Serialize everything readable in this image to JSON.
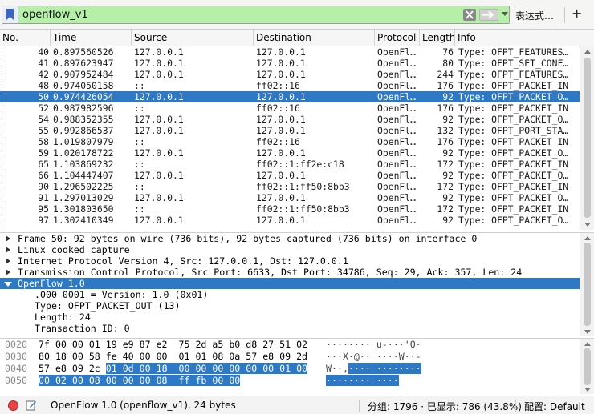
{
  "filter": {
    "value": "openflow_v1",
    "expression_label": "表达式…",
    "add_label": "+"
  },
  "packet_list": {
    "columns": [
      "No.",
      "Time",
      "Source",
      "Destination",
      "Protocol",
      "Length",
      "Info"
    ],
    "selected_no": "50",
    "rows": [
      {
        "no": "40",
        "time": "0.897560526",
        "source": "127.0.0.1",
        "destination": "127.0.0.1",
        "protocol": "OpenFl…",
        "length": "76",
        "info": "Type: OFPT_FEATURES…"
      },
      {
        "no": "41",
        "time": "0.897623947",
        "source": "127.0.0.1",
        "destination": "127.0.0.1",
        "protocol": "OpenFl…",
        "length": "80",
        "info": "Type: OFPT_SET_CONF…"
      },
      {
        "no": "42",
        "time": "0.907952484",
        "source": "127.0.0.1",
        "destination": "127.0.0.1",
        "protocol": "OpenFl…",
        "length": "244",
        "info": "Type: OFPT_FEATURES…"
      },
      {
        "no": "48",
        "time": "0.974050158",
        "source": "::",
        "destination": "ff02::16",
        "protocol": "OpenFl…",
        "length": "176",
        "info": "Type: OFPT_PACKET_IN"
      },
      {
        "no": "50",
        "time": "0.974426054",
        "source": "127.0.0.1",
        "destination": "127.0.0.1",
        "protocol": "OpenFl…",
        "length": "92",
        "info": "Type: OFPT_PACKET_O…"
      },
      {
        "no": "52",
        "time": "0.987982596",
        "source": "::",
        "destination": "ff02::16",
        "protocol": "OpenFl…",
        "length": "176",
        "info": "Type: OFPT_PACKET_IN"
      },
      {
        "no": "54",
        "time": "0.988352355",
        "source": "127.0.0.1",
        "destination": "127.0.0.1",
        "protocol": "OpenFl…",
        "length": "92",
        "info": "Type: OFPT_PACKET_O…"
      },
      {
        "no": "55",
        "time": "0.992866537",
        "source": "127.0.0.1",
        "destination": "127.0.0.1",
        "protocol": "OpenFl…",
        "length": "132",
        "info": "Type: OFPT_PORT_STA…"
      },
      {
        "no": "58",
        "time": "1.019807979",
        "source": "::",
        "destination": "ff02::16",
        "protocol": "OpenFl…",
        "length": "176",
        "info": "Type: OFPT_PACKET_IN"
      },
      {
        "no": "59",
        "time": "1.020178722",
        "source": "127.0.0.1",
        "destination": "127.0.0.1",
        "protocol": "OpenFl…",
        "length": "92",
        "info": "Type: OFPT_PACKET_O…"
      },
      {
        "no": "65",
        "time": "1.103869232",
        "source": "::",
        "destination": "ff02::1:ff2e:c18",
        "protocol": "OpenFl…",
        "length": "172",
        "info": "Type: OFPT_PACKET_IN"
      },
      {
        "no": "66",
        "time": "1.104447407",
        "source": "127.0.0.1",
        "destination": "127.0.0.1",
        "protocol": "OpenFl…",
        "length": "92",
        "info": "Type: OFPT_PACKET_O…"
      },
      {
        "no": "90",
        "time": "1.296502225",
        "source": "::",
        "destination": "ff02::1:ff50:8bb3",
        "protocol": "OpenFl…",
        "length": "172",
        "info": "Type: OFPT_PACKET_IN"
      },
      {
        "no": "91",
        "time": "1.297013029",
        "source": "127.0.0.1",
        "destination": "127.0.0.1",
        "protocol": "OpenFl…",
        "length": "92",
        "info": "Type: OFPT_PACKET_O…"
      },
      {
        "no": "95",
        "time": "1.301803650",
        "source": "::",
        "destination": "ff02::1:ff50:8bb3",
        "protocol": "OpenFl…",
        "length": "172",
        "info": "Type: OFPT_PACKET_IN"
      },
      {
        "no": "97",
        "time": "1.302410349",
        "source": "127.0.0.1",
        "destination": "127.0.0.1",
        "protocol": "OpenFl…",
        "length": "92",
        "info": "Type: OFPT_PACKET_O…"
      }
    ]
  },
  "details": {
    "items": [
      {
        "text": "Frame 50: 92 bytes on wire (736 bits), 92 bytes captured (736 bits) on interface 0",
        "level": 0,
        "expanded": false
      },
      {
        "text": "Linux cooked capture",
        "level": 0,
        "expanded": false
      },
      {
        "text": "Internet Protocol Version 4, Src: 127.0.0.1, Dst: 127.0.0.1",
        "level": 0,
        "expanded": false
      },
      {
        "text": "Transmission Control Protocol, Src Port: 6633, Dst Port: 34786, Seq: 29, Ack: 357, Len: 24",
        "level": 0,
        "expanded": false
      },
      {
        "text": "OpenFlow 1.0",
        "level": 0,
        "expanded": true,
        "selected": true
      },
      {
        "text": ".000 0001 = Version: 1.0 (0x01)",
        "level": 1
      },
      {
        "text": "Type: OFPT_PACKET_OUT (13)",
        "level": 1
      },
      {
        "text": "Length: 24",
        "level": 1
      },
      {
        "text": "Transaction ID: 0",
        "level": 1
      }
    ]
  },
  "hex": {
    "rows": [
      {
        "offset": "0020",
        "bytes": "7f 00 00 01 19 e9 87 e2  75 2d a5 b0 d8 27 51 02",
        "bytes_hl": "",
        "ascii": "········ u-···'Q·",
        "ascii_hl": ""
      },
      {
        "offset": "0030",
        "bytes": "80 18 00 58 fe 40 00 00  01 01 08 0a 57 e8 09 2d",
        "bytes_hl": "",
        "ascii": "···X·@·· ····W··-",
        "ascii_hl": ""
      },
      {
        "offset": "0040",
        "bytes": "57 e8 09 2c ",
        "bytes_hl": "01 0d 00 18  00 00 00 00 00 00 01 00",
        "ascii": "W··,",
        "ascii_hl": "···· ········"
      },
      {
        "offset": "0050",
        "bytes": "",
        "bytes_hl": "00 02 00 08 00 00 00 08  ff fb 00 00",
        "ascii": "",
        "ascii_hl": "········ ····"
      }
    ]
  },
  "status": {
    "text": "OpenFlow 1.0 (openflow_v1), 24 bytes",
    "packets": "分组: 1796 · 已显示: 786 (43.8%)",
    "profile": "配置: Default"
  },
  "colors": {
    "filter_valid": "#b6f0a8",
    "selection": "#2d79c6"
  }
}
